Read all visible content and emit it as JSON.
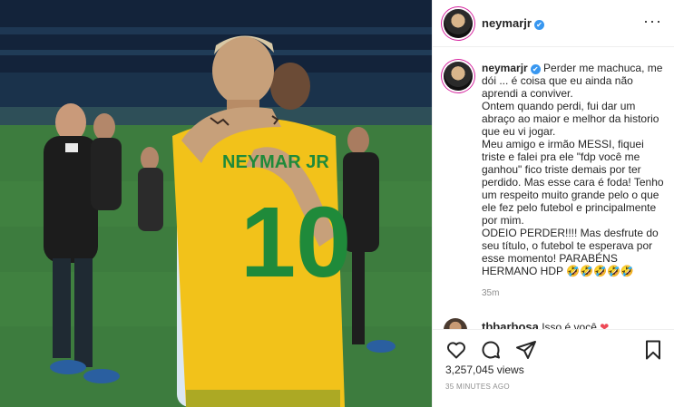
{
  "post": {
    "username": "neymarjr",
    "verified_mark": "✔",
    "more_label": "···",
    "jersey": {
      "name": "NEYMAR JR",
      "number": "10"
    }
  },
  "caption": {
    "username": "neymarjr",
    "lines": [
      "Perder me machuca, me dói ... é coisa que eu ainda não aprendi a conviver.",
      "Ontem quando perdi, fui dar um abraço ao maior e melhor da historio que eu vi jogar.",
      "Meu amigo e irmão MESSI, fiquei triste e falei pra ele \"fdp você me ganhou\" fico triste demais por ter perdido. Mas esse cara é foda! Tenho um respeito muito grande pelo o que ele fez pelo futebol e principalmente por mim.",
      "ODEIO PERDER!!!! Mas desfrute do seu título, o futebol te esperava por esse momento! PARABÉNS HERMANO HDP 🤣🤣🤣🤣🤣"
    ],
    "time": "35m"
  },
  "reply": {
    "username": "tbbarbosa",
    "text": "Isso é você",
    "emoji": "❤"
  },
  "stats": {
    "views": "3,257,045 views",
    "posted": "35 MINUTES AGO"
  },
  "icons": {
    "like": "heart-icon",
    "comment": "comment-icon",
    "share": "share-icon",
    "save": "bookmark-icon"
  },
  "colors": {
    "verified": "#3897f0",
    "jersey_yellow": "#f2c21a",
    "jersey_green": "#1f8a3a",
    "muted": "#8e8e8e"
  }
}
